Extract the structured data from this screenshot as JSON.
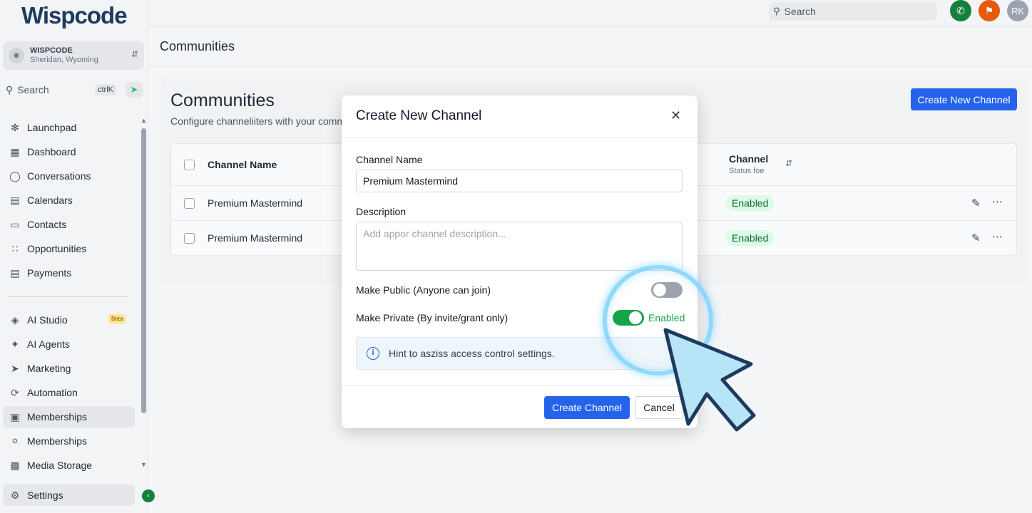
{
  "brand": {
    "logo": "Wispcode"
  },
  "location": {
    "name": "WISPCODE",
    "sub": "Sheridan, Wyoming"
  },
  "sidebar": {
    "search_label": "Search",
    "shortcut": "ctrlK",
    "items": [
      {
        "label": "Launchpad"
      },
      {
        "label": "Dashboard"
      },
      {
        "label": "Conversations"
      },
      {
        "label": "Calendars"
      },
      {
        "label": "Contacts"
      },
      {
        "label": "Opportunities"
      },
      {
        "label": "Payments"
      },
      {
        "label": "AI Studio"
      },
      {
        "label": "AI Agents"
      },
      {
        "label": "Marketing"
      },
      {
        "label": "Automation"
      },
      {
        "label": "Memberships"
      },
      {
        "label": "Memberships"
      },
      {
        "label": "Media Storage"
      },
      {
        "label": "Settings"
      }
    ],
    "beta": "Beta"
  },
  "topbar": {
    "search_placeholder": "Search",
    "avatar": "RK"
  },
  "page": {
    "header": "Communities"
  },
  "card": {
    "title": "Communities",
    "subtitle": "Configure channeliiters with your comm",
    "create_button": "Create New Channel"
  },
  "table": {
    "headers": {
      "name": "Channel Name",
      "status": "Channel",
      "status_sub": "Status foe"
    },
    "rows": [
      {
        "name": "Premium Mastermind",
        "status": "Enabled"
      },
      {
        "name": "Premium Mastermind",
        "status": "Enabled"
      }
    ]
  },
  "modal": {
    "title": "Create New Channel",
    "name_label": "Channel Name",
    "name_value": "Premium Mastermind",
    "desc_label": "Description",
    "desc_placeholder": "Add appor channel description...",
    "public_label": "Make Public (Anyone can join)",
    "private_label": "Make Private (By invite/grant only)",
    "private_status": "Enabled",
    "hint": "Hint to asziss access control settings.",
    "create_button": "Create Channel",
    "cancel_button": "Cancel"
  },
  "colors": {
    "primary": "#2563eb",
    "success": "#16a34a",
    "cursor": "#7dd3fc"
  }
}
